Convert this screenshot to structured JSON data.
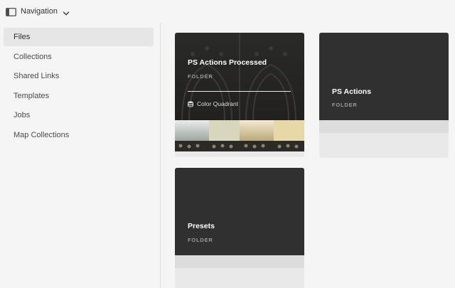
{
  "header": {
    "nav_label": "Navigation",
    "nav_icon": "sidebar-toggle-icon",
    "chevron_icon": "chevron-down-icon"
  },
  "sidebar": {
    "items": [
      {
        "label": "Files",
        "active": true
      },
      {
        "label": "Collections",
        "active": false
      },
      {
        "label": "Shared Links",
        "active": false
      },
      {
        "label": "Templates",
        "active": false
      },
      {
        "label": "Jobs",
        "active": false
      },
      {
        "label": "Map Collections",
        "active": false
      }
    ]
  },
  "folders": [
    {
      "title": "PS Actions Processed",
      "kind": "FOLDER",
      "meta_label": "Color Quadrant",
      "meta_icon": "database-icon",
      "has_image": true
    },
    {
      "title": "PS Actions",
      "kind": "FOLDER",
      "has_image": false
    },
    {
      "title": "Presets",
      "kind": "FOLDER",
      "has_image": false
    }
  ],
  "colors": {
    "card_dark": "#303030",
    "card_footer": "#e9e9e9",
    "active_nav": "#e6e6e6",
    "background": "#f5f5f5"
  }
}
